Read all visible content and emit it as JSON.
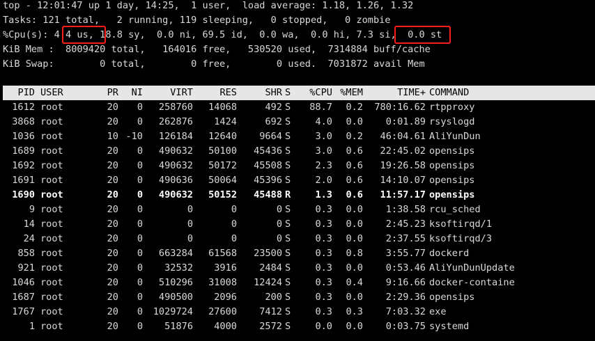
{
  "summary": {
    "line1": "top - 12:01:47 up 1 day, 14:25,  1 user,  load average: 1.18, 1.26, 1.32",
    "line2": "Tasks: 121 total,   2 running, 119 sleeping,   0 stopped,   0 zombie",
    "cpu_prefix": "%Cpu(s): ",
    "cpu_us": "4.4 us",
    "cpu_mid": ", 18.8 sy,  0.0 ni, 69.5 id,  0.0 wa,  0.0 hi, ",
    "cpu_si": "7.3 si,",
    "cpu_suffix": "  0.0 st",
    "mem": "KiB Mem :  8009420 total,   164016 free,   530520 used,  7314884 buff/cache",
    "swap": "KiB Swap:        0 total,        0 free,        0 used.  7031872 avail Mem"
  },
  "columns": [
    "PID",
    "USER",
    "PR",
    "NI",
    "VIRT",
    "RES",
    "SHR",
    "S",
    "%CPU",
    "%MEM",
    "TIME+",
    "COMMAND"
  ],
  "processes": [
    {
      "pid": "1612",
      "user": "root",
      "pr": "20",
      "ni": "0",
      "virt": "258760",
      "res": "14068",
      "shr": "492",
      "s": "S",
      "cpu": "88.7",
      "mem": "0.2",
      "time": "780:16.62",
      "command": "rtpproxy"
    },
    {
      "pid": "3868",
      "user": "root",
      "pr": "20",
      "ni": "0",
      "virt": "262876",
      "res": "1424",
      "shr": "692",
      "s": "S",
      "cpu": "4.0",
      "mem": "0.0",
      "time": "0:01.89",
      "command": "rsyslogd"
    },
    {
      "pid": "1036",
      "user": "root",
      "pr": "10",
      "ni": "-10",
      "virt": "126184",
      "res": "12640",
      "shr": "9664",
      "s": "S",
      "cpu": "3.0",
      "mem": "0.2",
      "time": "46:04.61",
      "command": "AliYunDun"
    },
    {
      "pid": "1689",
      "user": "root",
      "pr": "20",
      "ni": "0",
      "virt": "490632",
      "res": "50100",
      "shr": "45436",
      "s": "S",
      "cpu": "3.0",
      "mem": "0.6",
      "time": "22:45.02",
      "command": "opensips"
    },
    {
      "pid": "1692",
      "user": "root",
      "pr": "20",
      "ni": "0",
      "virt": "490632",
      "res": "50172",
      "shr": "45508",
      "s": "S",
      "cpu": "2.3",
      "mem": "0.6",
      "time": "19:26.58",
      "command": "opensips"
    },
    {
      "pid": "1691",
      "user": "root",
      "pr": "20",
      "ni": "0",
      "virt": "490636",
      "res": "50064",
      "shr": "45396",
      "s": "S",
      "cpu": "2.0",
      "mem": "0.6",
      "time": "14:10.07",
      "command": "opensips"
    },
    {
      "pid": "1690",
      "user": "root",
      "pr": "20",
      "ni": "0",
      "virt": "490632",
      "res": "50152",
      "shr": "45488",
      "s": "R",
      "cpu": "1.3",
      "mem": "0.6",
      "time": "11:57.17",
      "command": "opensips",
      "bold": true
    },
    {
      "pid": "9",
      "user": "root",
      "pr": "20",
      "ni": "0",
      "virt": "0",
      "res": "0",
      "shr": "0",
      "s": "S",
      "cpu": "0.3",
      "mem": "0.0",
      "time": "1:38.58",
      "command": "rcu_sched"
    },
    {
      "pid": "14",
      "user": "root",
      "pr": "20",
      "ni": "0",
      "virt": "0",
      "res": "0",
      "shr": "0",
      "s": "S",
      "cpu": "0.3",
      "mem": "0.0",
      "time": "2:45.23",
      "command": "ksoftirqd/1"
    },
    {
      "pid": "24",
      "user": "root",
      "pr": "20",
      "ni": "0",
      "virt": "0",
      "res": "0",
      "shr": "0",
      "s": "S",
      "cpu": "0.3",
      "mem": "0.0",
      "time": "2:37.55",
      "command": "ksoftirqd/3"
    },
    {
      "pid": "858",
      "user": "root",
      "pr": "20",
      "ni": "0",
      "virt": "663284",
      "res": "61568",
      "shr": "23500",
      "s": "S",
      "cpu": "0.3",
      "mem": "0.8",
      "time": "3:55.77",
      "command": "dockerd"
    },
    {
      "pid": "921",
      "user": "root",
      "pr": "20",
      "ni": "0",
      "virt": "32532",
      "res": "3916",
      "shr": "2484",
      "s": "S",
      "cpu": "0.3",
      "mem": "0.0",
      "time": "0:53.46",
      "command": "AliYunDunUpdate"
    },
    {
      "pid": "1046",
      "user": "root",
      "pr": "20",
      "ni": "0",
      "virt": "510296",
      "res": "31008",
      "shr": "12424",
      "s": "S",
      "cpu": "0.3",
      "mem": "0.4",
      "time": "9:16.66",
      "command": "docker-containe"
    },
    {
      "pid": "1687",
      "user": "root",
      "pr": "20",
      "ni": "0",
      "virt": "490500",
      "res": "2096",
      "shr": "200",
      "s": "S",
      "cpu": "0.3",
      "mem": "0.0",
      "time": "2:29.36",
      "command": "opensips"
    },
    {
      "pid": "1767",
      "user": "root",
      "pr": "20",
      "ni": "0",
      "virt": "1029724",
      "res": "27600",
      "shr": "7412",
      "s": "S",
      "cpu": "0.3",
      "mem": "0.3",
      "time": "7:03.32",
      "command": "exe"
    },
    {
      "pid": "1",
      "user": "root",
      "pr": "20",
      "ni": "0",
      "virt": "51876",
      "res": "4000",
      "shr": "2572",
      "s": "S",
      "cpu": "0.0",
      "mem": "0.0",
      "time": "0:03.75",
      "command": "systemd"
    }
  ],
  "colors": {
    "background": "#000000",
    "text": "#d9d9d9",
    "header_bg": "#e6e6e6",
    "highlight": "#ff1a1a"
  }
}
